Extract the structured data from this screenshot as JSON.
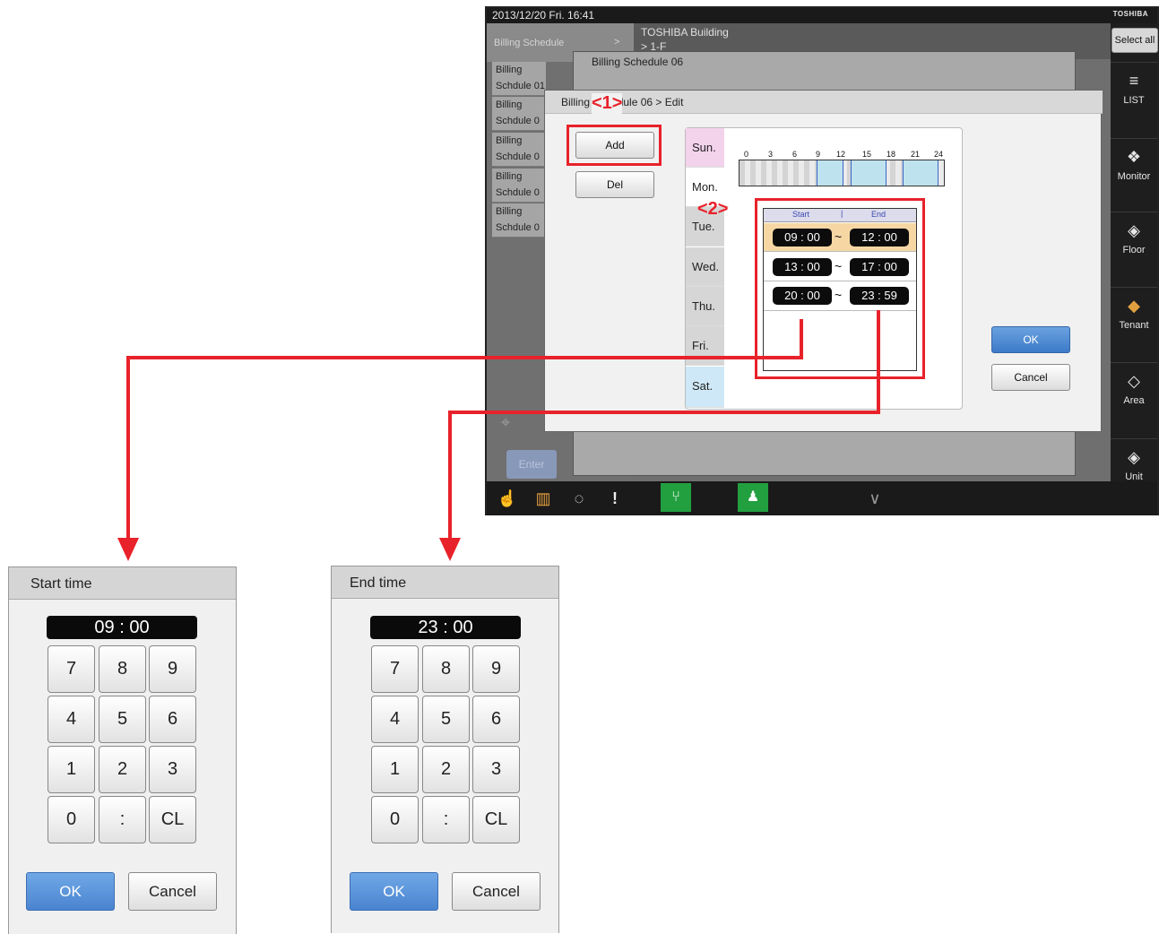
{
  "topbar": {
    "datetime": "2013/12/20  Fri.  16:41",
    "brand": "TOSHIBA"
  },
  "schedule_pane": {
    "header": "Billing Schedule",
    "items": [
      {
        "line1": "Billing",
        "line2": "Schdule 01"
      },
      {
        "line1": "Billing",
        "line2": "Schdule 0"
      },
      {
        "line1": "Billing",
        "line2": "Schdule 0"
      },
      {
        "line1": "Billing",
        "line2": "Schdule 0"
      },
      {
        "line1": "Billing",
        "line2": "Schdule 0"
      }
    ],
    "enter": "Enter"
  },
  "building": {
    "title": "TOSHIBA Building",
    "sub": "> 1-F"
  },
  "rail": {
    "select_all": "Select all",
    "items": [
      {
        "label": "LIST",
        "icon": "list-icon"
      },
      {
        "label": "Monitor",
        "icon": "monitor-icon"
      },
      {
        "label": "Floor",
        "icon": "floor-icon"
      },
      {
        "label": "Tenant",
        "icon": "tenant-icon"
      },
      {
        "label": "Area",
        "icon": "area-icon"
      },
      {
        "label": "Unit",
        "icon": "unit-icon"
      }
    ]
  },
  "bg_dialog": {
    "title": "Billing Schedule 06"
  },
  "edit_dialog": {
    "breadcrumb": "Billing Schedule 06 > Edit",
    "add": "Add",
    "del": "Del",
    "ok": "OK",
    "cancel": "Cancel",
    "days": [
      "Sun.",
      "Mon.",
      "Tue.",
      "Wed.",
      "Thu.",
      "Fri.",
      "Sat."
    ],
    "ticks": [
      "0",
      "3",
      "6",
      "9",
      "12",
      "15",
      "18",
      "21",
      "24"
    ],
    "list_header": {
      "start": "Start",
      "end": "End"
    },
    "periods": [
      {
        "start": "09 : 00",
        "end": "12 : 00"
      },
      {
        "start": "13 : 00",
        "end": "17 : 00"
      },
      {
        "start": "20 : 00",
        "end": "23 : 59"
      }
    ]
  },
  "callouts": {
    "one": "<1>",
    "two": "<2>"
  },
  "start_popup": {
    "title": "Start time",
    "value": "09 : 00",
    "keys": [
      "7",
      "8",
      "9",
      "4",
      "5",
      "6",
      "1",
      "2",
      "3",
      "0",
      ":",
      "CL"
    ],
    "ok": "OK",
    "cancel": "Cancel"
  },
  "end_popup": {
    "title": "End time",
    "value": "23 : 00",
    "keys": [
      "7",
      "8",
      "9",
      "4",
      "5",
      "6",
      "1",
      "2",
      "3",
      "0",
      ":",
      "CL"
    ],
    "ok": "OK",
    "cancel": "Cancel"
  },
  "colors": {
    "callout_red": "#e8222a",
    "ok_blue": "#4a84d0",
    "sunday_pink": "#f3d3ec",
    "saturday_blue": "#cfe8f7",
    "selected_orange": "#f0b650"
  }
}
